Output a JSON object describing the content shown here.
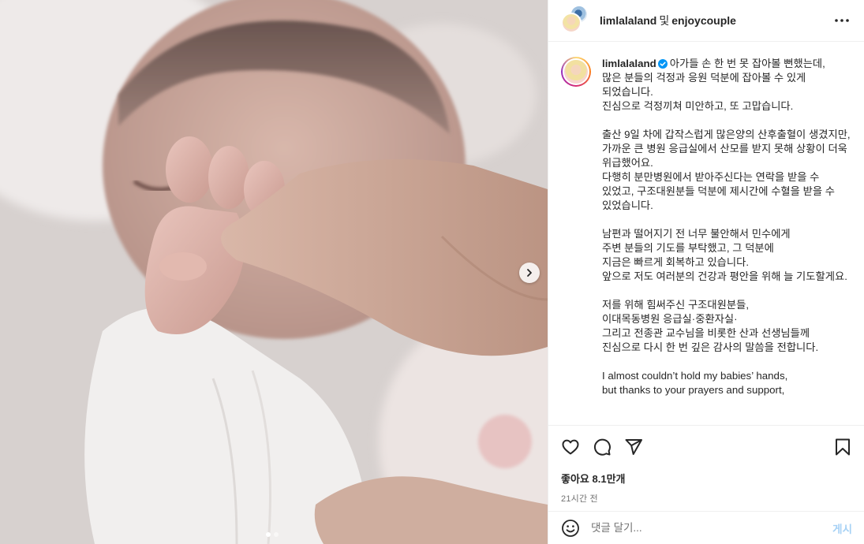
{
  "header": {
    "author": "limlalaland",
    "conjunction": "및",
    "collaborator": "enjoycouple",
    "more_icon": "more-horizontal-icon"
  },
  "caption": {
    "username": "limlalaland",
    "verified": true,
    "text": "아가들 손 한 번 못 잡아볼 뻔했는데,\n많은 분들의 걱정과 응원 덕분에 잡아볼 수 있게 되었습니다.\n진심으로 걱정끼쳐 미안하고, 또 고맙습니다.\n\n출산 9일 차에 갑작스럽게 많은양의 산후출혈이 생겼지만,\n가까운 큰 병원 응급실에서 산모를 받지 못해 상황이 더욱 위급했어요.\n다행히 분만병원에서 받아주신다는 연락을 받을 수 있었고, 구조대원분들 덕분에 제시간에 수혈을 받을 수 있었습니다.\n\n남편과 떨어지기 전 너무 불안해서 민수에게\n주변 분들의 기도를 부탁했고, 그 덕분에\n지금은 빠르게 회복하고 있습니다.\n앞으로 저도 여러분의 건강과 평안을 위해 늘 기도할게요.\n\n저를 위해 힘써주신 구조대원분들,\n이대목동병원 응급실·중환자실·\n그리고 전종관 교수님을 비롯한 산과 선생님들께\n진심으로 다시 한 번 깊은 감사의 말씀을 전합니다.\n\nI almost couldn’t hold my babies’ hands,\nbut thanks to your prayers and support,"
  },
  "media": {
    "next_icon": "chevron-right-icon",
    "total_slides": 2,
    "current_slide": 1
  },
  "actions": {
    "like_icon": "heart-icon",
    "comment_icon": "comment-icon",
    "share_icon": "send-icon",
    "save_icon": "bookmark-icon",
    "likes_text": "좋아요 8.1만개",
    "time_text": "21시간 전"
  },
  "comment": {
    "placeholder": "댓글 달기...",
    "post_label": "게시",
    "emoji_icon": "emoji-icon"
  },
  "colors": {
    "verified": "#0095f6",
    "post_disabled": "#a6d1f5",
    "muted": "#737373"
  }
}
